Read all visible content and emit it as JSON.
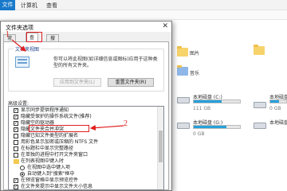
{
  "explorer": {
    "tab_file": "文件",
    "tab_computer": "计算机",
    "tab_view": "查看",
    "items": {
      "pictures": "图片",
      "music": "音乐",
      "disk_c": "本地磁盘 (C:)",
      "disk_c_free": "111 GB",
      "disk_e": "本地磁盘 (E:)",
      "disk_e_free": "0 GB",
      "disk_f": "本地磁盘 (F:)",
      "disk_g": "本地磁盘 (G:)",
      "disk_g_free": "0 GB",
      "disk_c_fill": 0.6,
      "disk_e_fill": 0.55,
      "disk_g_fill": 0.7
    }
  },
  "dialog": {
    "title": "文件夹选项",
    "close": "✕",
    "tabs": [
      "常规",
      "查看",
      "搜索"
    ],
    "group_label": "文件夹视图",
    "group_desc": "你可以将此视图(如详细信息或图标)应用于这种类型的所有文件夹。",
    "btn_apply": "应用到文件夹(L)",
    "btn_reset": "重置文件夹(R)",
    "advanced_label": "高级设置:",
    "advanced_rows": [
      "显示同步提供程序通知",
      "隐藏受保护的操作系统文件(推荐)",
      "隐藏空的驱动器",
      "隐藏文件夹合并冲突",
      "隐藏已知文件类型的扩展名",
      "用彩色显示加密或压缩的 NTFS 文件",
      "在标题栏中显示完整路径",
      "在单独的进程中打开文件夹窗口",
      "在列表视图中键入时",
      "在视图中选中键入项",
      "自动键入到\"搜索\"框中",
      "在预览窗格中显示预览控件",
      "在文件夹提示中显示文件大小信息"
    ]
  },
  "annotations": {
    "one": "1",
    "two": "2"
  },
  "colors": {
    "annotation": "#e02020",
    "accent": "#1979ca",
    "capacity": "#26a0da"
  }
}
